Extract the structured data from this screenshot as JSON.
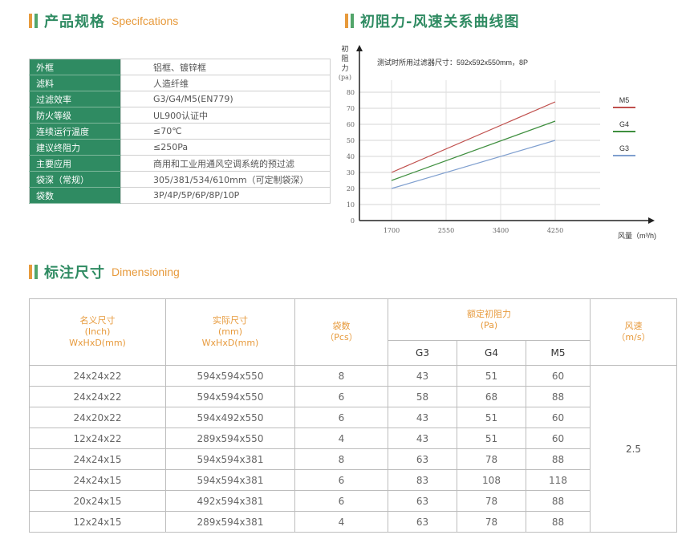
{
  "sections": {
    "specs": {
      "zh": "产品规格",
      "en": "Specifcations"
    },
    "chart": {
      "zh": "初阻力-风速关系曲线图"
    },
    "dims": {
      "zh": "标注尺寸",
      "en": "Dimensioning"
    }
  },
  "specs": [
    {
      "k": "外框",
      "v": "铝框、镀锌框"
    },
    {
      "k": "滤料",
      "v": "人造纤维"
    },
    {
      "k": "过滤效率",
      "v": "G3/G4/M5(EN779)"
    },
    {
      "k": "防火等级",
      "v": "UL900认证中"
    },
    {
      "k": "连续运行温度",
      "v": "≤70℃"
    },
    {
      "k": "建议终阻力",
      "v": "≤250Pa"
    },
    {
      "k": "主要应用",
      "v": "商用和工业用通风空调系统的预过滤"
    },
    {
      "k": "袋深（常规）",
      "v": "305/381/534/610mm（可定制袋深）"
    },
    {
      "k": "袋数",
      "v": "3P/4P/5P/6P/8P/10P"
    }
  ],
  "chart_data": {
    "type": "line",
    "title": "测试时所用过滤器尺寸：592x592x550mm，8P",
    "ylabel_lines": [
      "初",
      "阻",
      "力"
    ],
    "yunit": "(pa)",
    "xlabel": "风量（m³/h)",
    "x": [
      1700,
      4250
    ],
    "xticks": [
      1700,
      2550,
      3400,
      4250
    ],
    "yticks": [
      0,
      10,
      20,
      30,
      40,
      50,
      60,
      70,
      80
    ],
    "xlim": [
      1700,
      4250
    ],
    "ylim": [
      0,
      80
    ],
    "grid": true,
    "legend": "right",
    "series": [
      {
        "name": "M5",
        "values": [
          30,
          74
        ],
        "color": "#c0504d"
      },
      {
        "name": "G4",
        "values": [
          25,
          62
        ],
        "color": "#3f8f3f"
      },
      {
        "name": "G3",
        "values": [
          20,
          50
        ],
        "color": "#7f9fcf"
      }
    ]
  },
  "dims": {
    "headers": {
      "nominal": [
        "名义尺寸",
        "(Inch)",
        "WxHxD(mm)"
      ],
      "actual": [
        "实际尺寸",
        "(mm)",
        "WxHxD(mm)"
      ],
      "pockets": [
        "袋数",
        "（Pcs）"
      ],
      "resistance": [
        "额定初阻力",
        "(Pa)"
      ],
      "speed": [
        "风速",
        "（m/s）"
      ],
      "grades": [
        "G3",
        "G4",
        "M5"
      ]
    },
    "speed_value": "2.5",
    "rows": [
      {
        "nominal": "24x24x22",
        "actual": "594x594x550",
        "pockets": "8",
        "g3": "43",
        "g4": "51",
        "m5": "60"
      },
      {
        "nominal": "24x24x22",
        "actual": "594x594x550",
        "pockets": "6",
        "g3": "58",
        "g4": "68",
        "m5": "88"
      },
      {
        "nominal": "24x20x22",
        "actual": "594x492x550",
        "pockets": "6",
        "g3": "43",
        "g4": "51",
        "m5": "60"
      },
      {
        "nominal": "12x24x22",
        "actual": "289x594x550",
        "pockets": "4",
        "g3": "43",
        "g4": "51",
        "m5": "60"
      },
      {
        "nominal": "24x24x15",
        "actual": "594x594x381",
        "pockets": "8",
        "g3": "63",
        "g4": "78",
        "m5": "88"
      },
      {
        "nominal": "24x24x15",
        "actual": "594x594x381",
        "pockets": "6",
        "g3": "83",
        "g4": "108",
        "m5": "118"
      },
      {
        "nominal": "20x24x15",
        "actual": "492x594x381",
        "pockets": "6",
        "g3": "63",
        "g4": "78",
        "m5": "88"
      },
      {
        "nominal": "12x24x15",
        "actual": "289x594x381",
        "pockets": "4",
        "g3": "63",
        "g4": "78",
        "m5": "88"
      }
    ]
  }
}
